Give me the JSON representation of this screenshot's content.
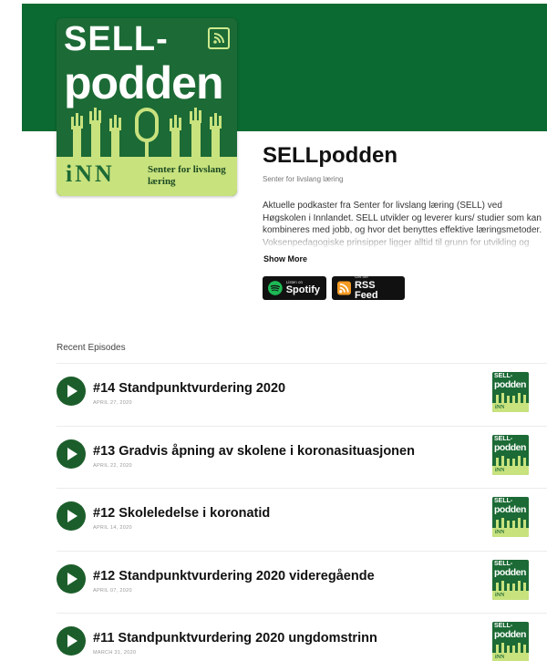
{
  "podcast": {
    "cover": {
      "line1": "SELL-",
      "line2": "podden",
      "logo": "iNN",
      "org": "Senter for livslang læring"
    },
    "title": "SELLpodden",
    "subtitle": "Senter for livslang læring",
    "description": "Aktuelle podkaster fra Senter for livslang læring (SELL) ved Høgskolen i Innlandet. SELL utvikler og leverer kurs/ studier som kan kombineres med jobb, og hvor det benyttes effektive læringsmetoder. Voksenpedagogiske prinsipper ligger alltid til grunn for utvikling og gjennomføring av kursene.",
    "show_more": "Show More",
    "badges": {
      "spotify_small": "Listen on",
      "spotify_big": "Spotify",
      "rss_small": "Get the",
      "rss_big": "RSS Feed"
    }
  },
  "recent_label": "Recent Episodes",
  "episodes": [
    {
      "title": "#14 Standpunktvurdering 2020",
      "date": "APRIL 27, 2020"
    },
    {
      "title": "#13 Gradvis åpning av skolene i koronasituasjonen",
      "date": "APRIL 22, 2020"
    },
    {
      "title": "#12 Skoleledelse i koronatid",
      "date": "APRIL 14, 2020"
    },
    {
      "title": "#12 Standpunktvurdering 2020 videregående",
      "date": "APRIL 07, 2020"
    },
    {
      "title": "#11 Standpunktvurdering 2020 ungdomstrinn",
      "date": "MARCH 31, 2020"
    }
  ],
  "colors": {
    "banner": "#0b6a31",
    "cover_green": "#1c6a35",
    "cover_lime": "#c8e27e",
    "play_button": "#1c5e2b",
    "spotify": "#1db954",
    "rss": "#f59a23"
  },
  "icons": [
    "rss-icon",
    "spotify-icon",
    "play-icon",
    "microphone-icon"
  ]
}
